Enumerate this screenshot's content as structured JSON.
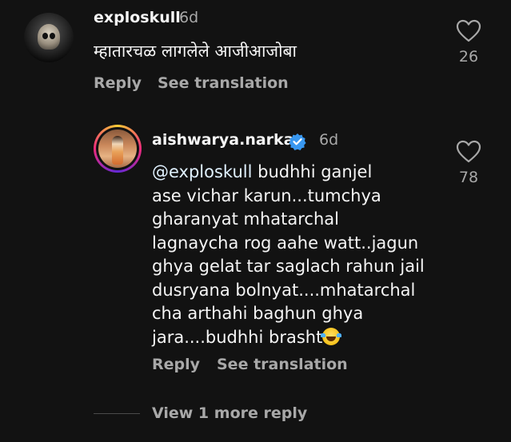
{
  "comment1": {
    "username": "exploskull",
    "time": "6d",
    "text": "म्हातारचळ लागलेले आजीआजोबा",
    "reply_label": "Reply",
    "translation_label": "See translation",
    "like_count": "26",
    "avatar_icon": "skull-icon"
  },
  "comment2": {
    "username": "aishwarya.narkar",
    "verified": true,
    "time": "6d",
    "mention": "@exploskull",
    "lines": [
      " budhhi ganjel",
      "ase vichar karun...tumchya",
      "gharanyat mhatarchal",
      "lagnaycha rog aahe watt..jagun",
      "ghya gelat tar saglach rahun jail",
      "dusryana bolnyat....mhatarchal",
      "cha arthahi baghun ghya",
      "jara....budhhi brasht"
    ],
    "emoji": "😂",
    "reply_label": "Reply",
    "translation_label": "See translation",
    "like_count": "78"
  },
  "view_more": "View 1 more reply",
  "colors": {
    "background": "#121212",
    "text_primary": "#f5f5f5",
    "text_secondary": "#a8a8a8",
    "verified_blue": "#3897f0"
  }
}
